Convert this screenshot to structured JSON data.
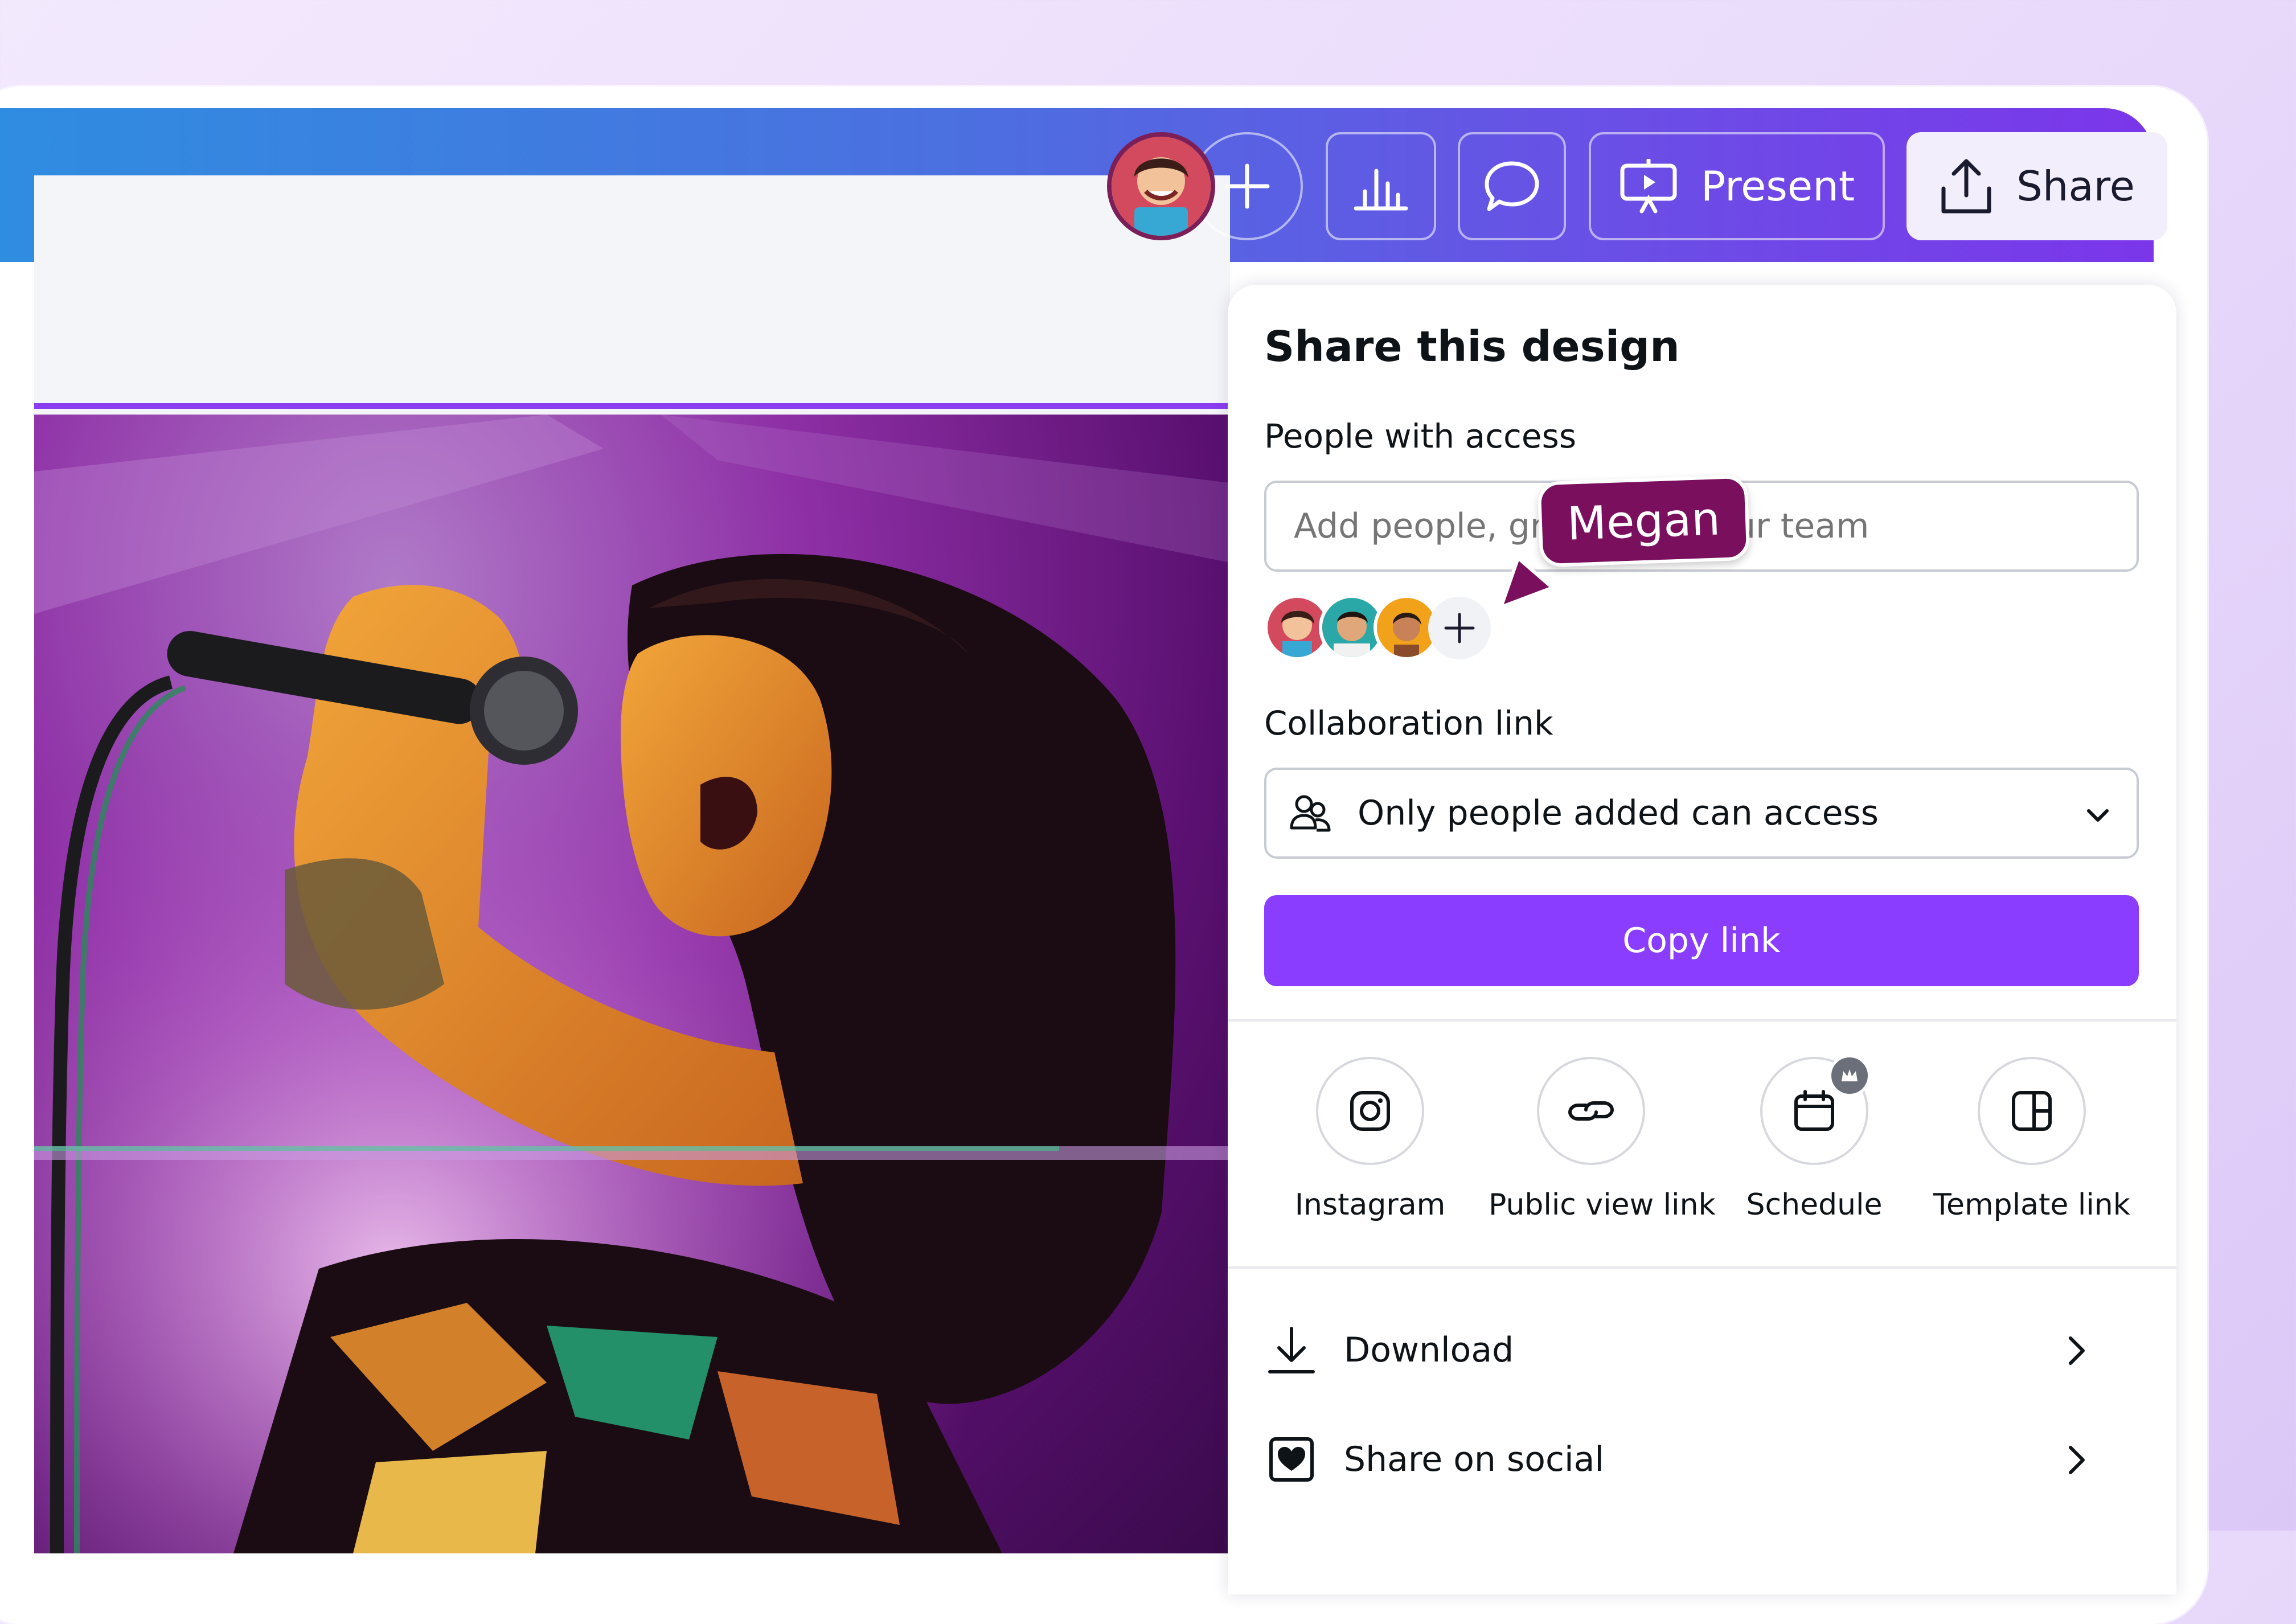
{
  "header": {
    "present_label": "Present",
    "share_label": "Share"
  },
  "share_panel": {
    "title": "Share this design",
    "people_heading": "People with access",
    "input_placeholder": "Add people, groups, or your team",
    "typing_user": "Megan",
    "collab_heading": "Collaboration link",
    "access_value": "Only people added can access",
    "copy_label": "Copy link",
    "options": [
      {
        "label": "Instagram",
        "icon": "instagram-icon"
      },
      {
        "label": "Public view link",
        "icon": "link-icon"
      },
      {
        "label": "Schedule",
        "icon": "calendar-icon"
      },
      {
        "label": "Template link",
        "icon": "template-icon"
      }
    ],
    "actions": [
      {
        "label": "Download",
        "icon": "download-icon"
      },
      {
        "label": "Share on social",
        "icon": "heart-icon"
      }
    ]
  },
  "colors": {
    "accent": "#8b3dff",
    "tag": "#7a0f5e",
    "header_start": "#2f8de0",
    "header_end": "#7b36ea"
  }
}
